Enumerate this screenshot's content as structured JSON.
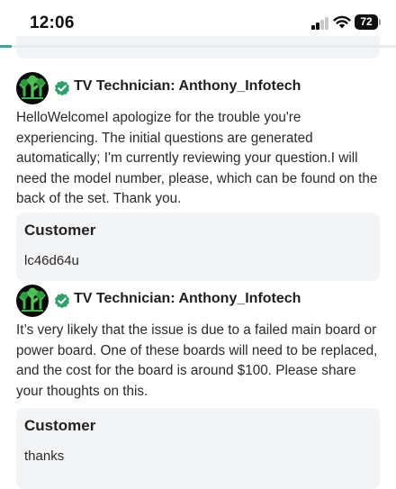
{
  "status_bar": {
    "time": "12:06",
    "battery_level": "72",
    "signal_bars_active": 2,
    "signal_bars_total": 4,
    "wifi": "wifi-icon"
  },
  "page_progress": 0.03,
  "colors": {
    "accent": "#3aa6a0",
    "verified_badge": "#2fa06b",
    "card_background": "#f3f4f6"
  },
  "conversation": [
    {
      "type": "expert",
      "author": "TV Technician: Anthony_Infotech",
      "verified_icon": "verified-check-icon",
      "avatar_icon": "tree-avatar-icon",
      "text": "HelloWelcomeI apologize for the trouble you're experiencing. The initial questions are generated automatically; I'm currently reviewing your question.I will need the model number, please, which can be found on the back of the set. Thank you."
    },
    {
      "type": "customer",
      "author": "Customer",
      "text": "lc46d64u"
    },
    {
      "type": "expert",
      "author": "TV Technician: Anthony_Infotech",
      "verified_icon": "verified-check-icon",
      "avatar_icon": "tree-avatar-icon",
      "text": "It’s very likely that the issue is due to a failed main board or power board. One of these boards will need to be replaced, and the cost for the board is around $100. Please share your thoughts on this."
    },
    {
      "type": "customer",
      "author": "Customer",
      "text": "thanks"
    }
  ]
}
